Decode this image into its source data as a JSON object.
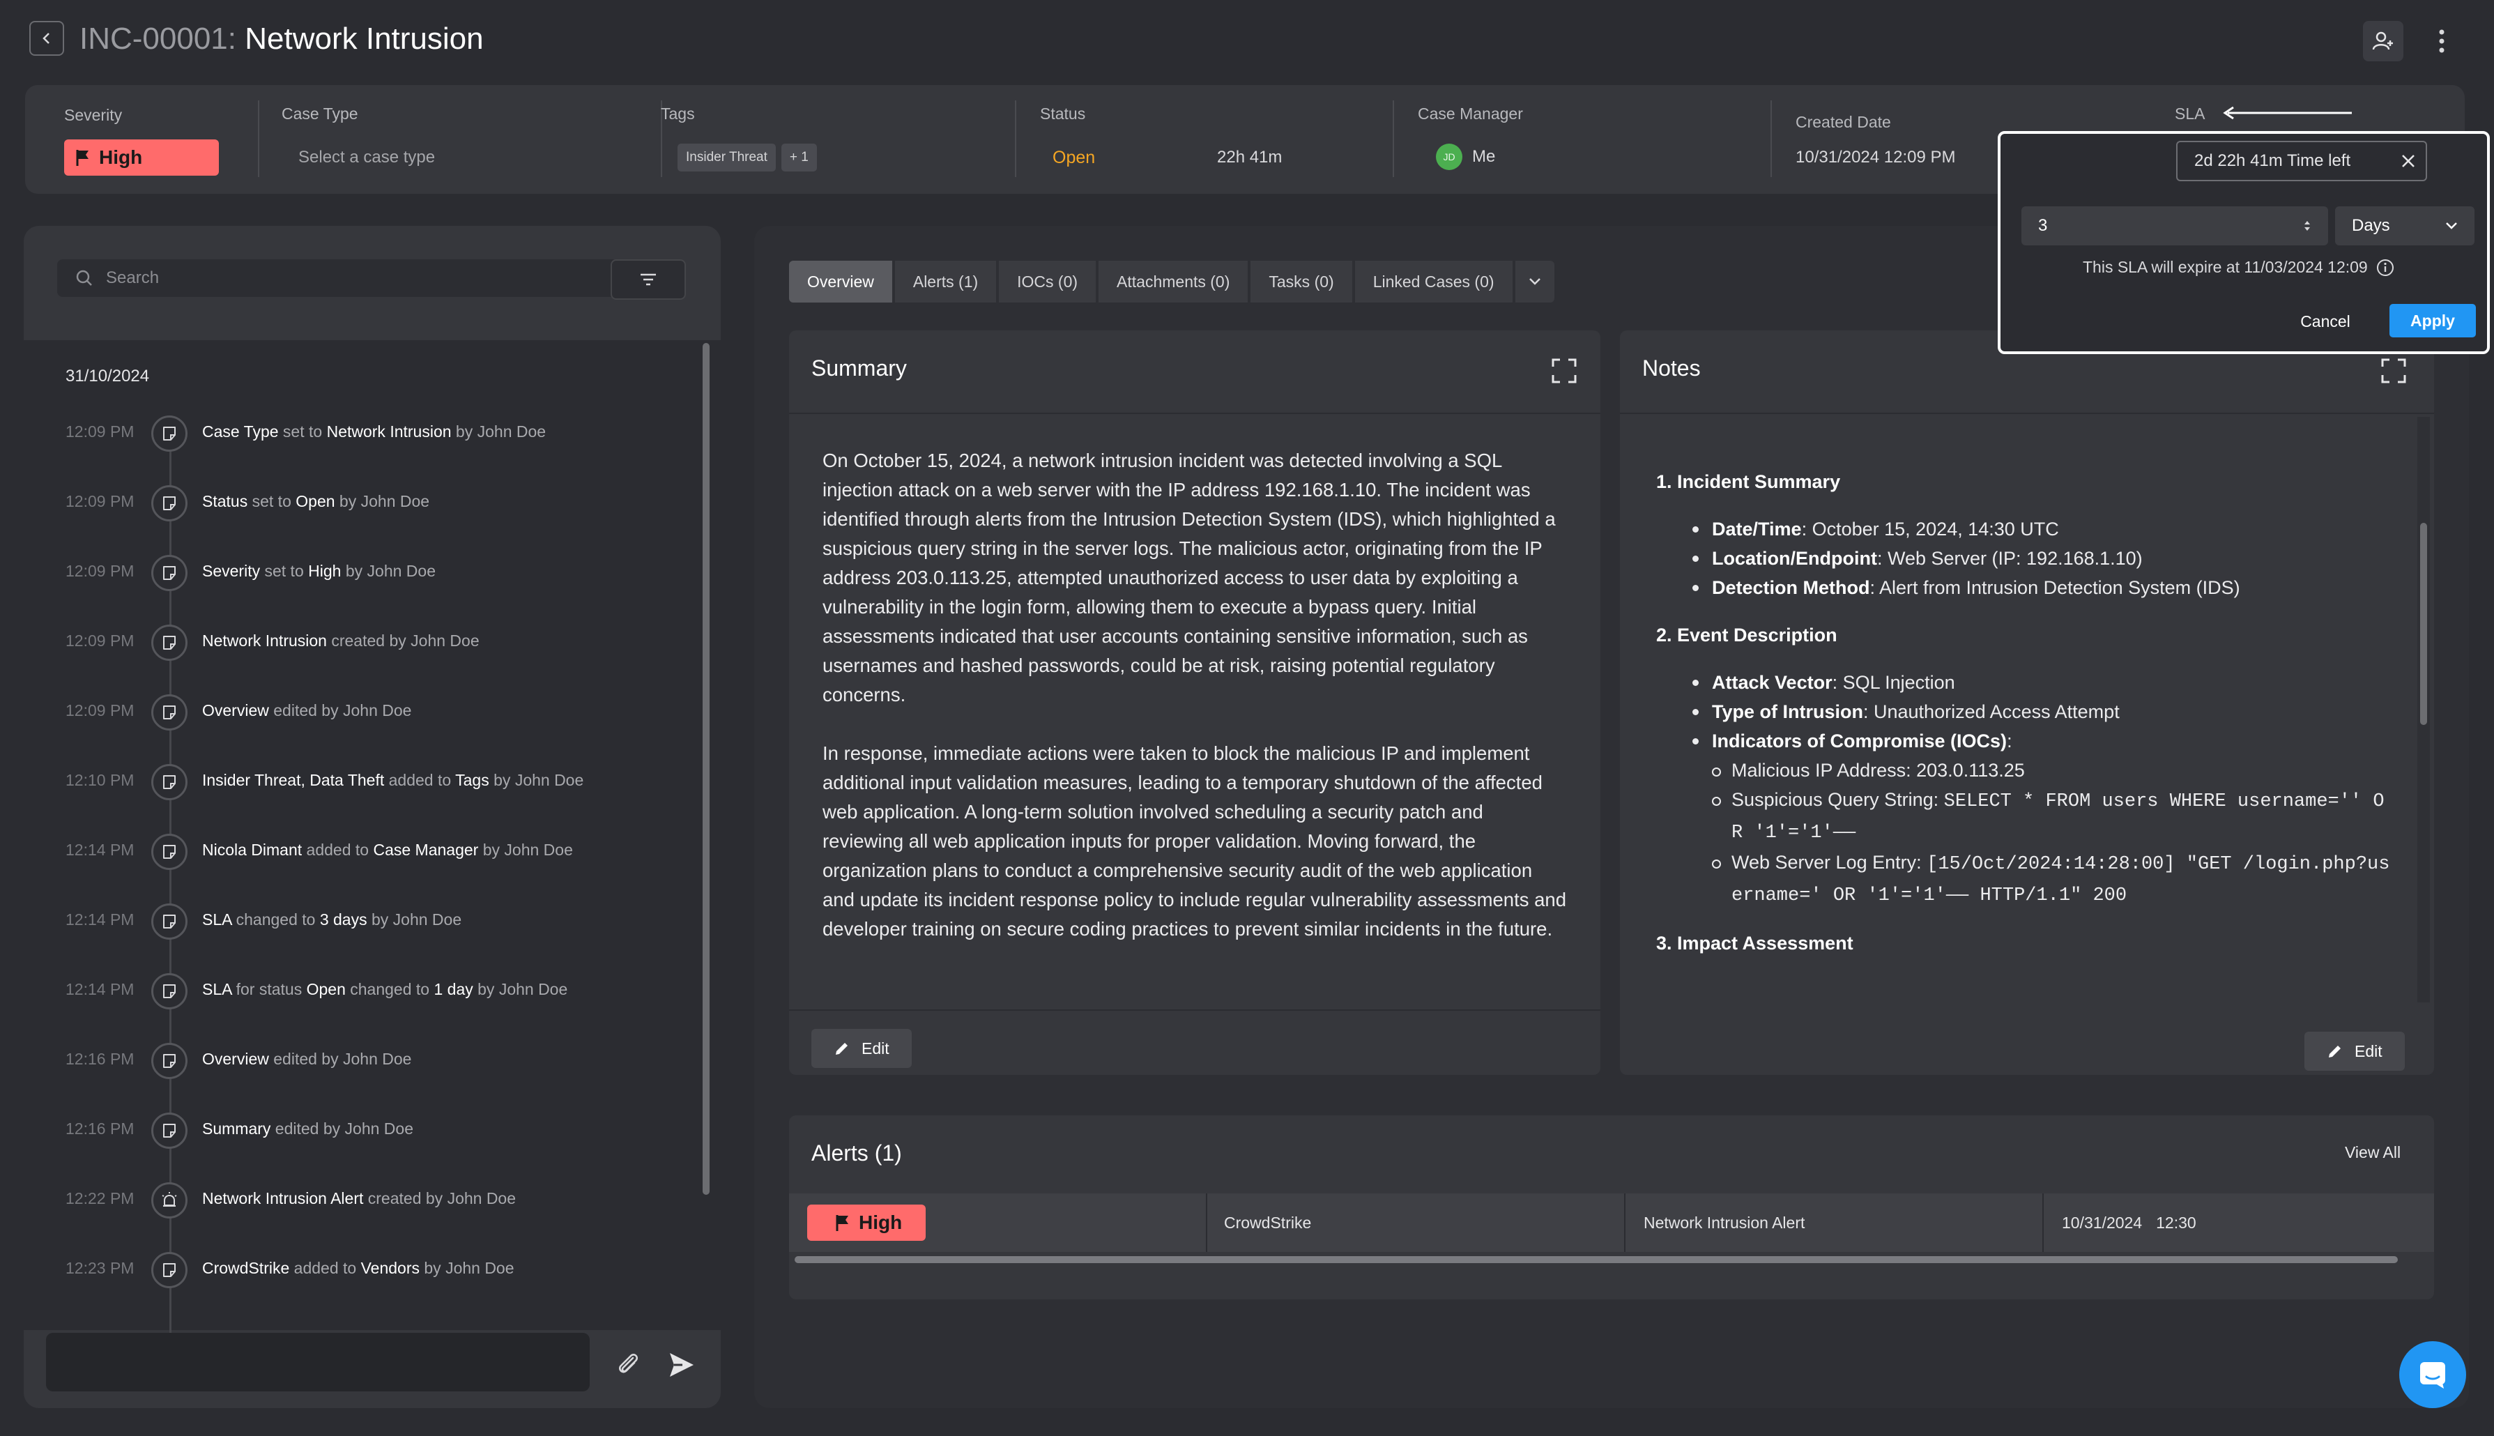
{
  "header": {
    "case_id": "INC-00001:",
    "case_title": "Network Intrusion"
  },
  "info_bar": {
    "severity_label": "Severity",
    "severity_value": "High",
    "case_type_label": "Case Type",
    "case_type_placeholder": "Select a case type",
    "tags_label": "Tags",
    "tags": [
      "Insider Threat",
      "+ 1"
    ],
    "status_label": "Status",
    "status_value": "Open",
    "status_time": "22h 41m",
    "case_manager_label": "Case Manager",
    "case_manager_initials": "JD",
    "case_manager_value": "Me",
    "created_label": "Created Date",
    "created_value": "10/31/2024 12:09 PM",
    "sla_label": "SLA"
  },
  "sla_popover": {
    "input_value": "2d 22h 41m Time left",
    "number_value": "3",
    "unit_value": "Days",
    "expire_text": "This SLA will expire at 11/03/2024 12:09",
    "cancel_label": "Cancel",
    "apply_label": "Apply"
  },
  "activity": {
    "search_placeholder": "Search",
    "date": "31/10/2024",
    "items": [
      {
        "time": "12:09 PM",
        "parts": [
          [
            "Case Type",
            "em"
          ],
          [
            " set to ",
            ""
          ],
          [
            "Network Intrusion",
            "em"
          ],
          [
            " by ",
            ""
          ],
          [
            "John Doe",
            ""
          ]
        ]
      },
      {
        "time": "12:09 PM",
        "parts": [
          [
            "Status",
            "em"
          ],
          [
            " set to ",
            ""
          ],
          [
            "Open",
            "em"
          ],
          [
            " by ",
            ""
          ],
          [
            "John Doe",
            ""
          ]
        ]
      },
      {
        "time": "12:09 PM",
        "parts": [
          [
            "Severity",
            "em"
          ],
          [
            " set to ",
            ""
          ],
          [
            "High",
            "em"
          ],
          [
            " by ",
            ""
          ],
          [
            "John Doe",
            ""
          ]
        ]
      },
      {
        "time": "12:09 PM",
        "parts": [
          [
            "Network Intrusion",
            "em"
          ],
          [
            " created by ",
            ""
          ],
          [
            "John Doe",
            ""
          ]
        ]
      },
      {
        "time": "12:09 PM",
        "parts": [
          [
            "Overview",
            "em"
          ],
          [
            " edited by ",
            ""
          ],
          [
            "John Doe",
            ""
          ]
        ]
      },
      {
        "time": "12:10 PM",
        "parts": [
          [
            "Insider Threat, Data Theft",
            "em"
          ],
          [
            " added to ",
            ""
          ],
          [
            "Tags",
            "em"
          ],
          [
            " by ",
            ""
          ],
          [
            "John Doe",
            ""
          ]
        ]
      },
      {
        "time": "12:14 PM",
        "parts": [
          [
            "Nicola Dimant",
            "em"
          ],
          [
            " added to ",
            ""
          ],
          [
            "Case Manager",
            "em"
          ],
          [
            " by ",
            ""
          ],
          [
            "John Doe",
            ""
          ]
        ]
      },
      {
        "time": "12:14 PM",
        "parts": [
          [
            "SLA",
            "em"
          ],
          [
            " changed to ",
            ""
          ],
          [
            "3 days",
            "em"
          ],
          [
            " by ",
            ""
          ],
          [
            "John Doe",
            ""
          ]
        ]
      },
      {
        "time": "12:14 PM",
        "parts": [
          [
            "SLA",
            "em"
          ],
          [
            " for status ",
            ""
          ],
          [
            "Open",
            "em"
          ],
          [
            " changed to ",
            ""
          ],
          [
            "1 day",
            "em"
          ],
          [
            " by ",
            ""
          ],
          [
            "John Doe",
            ""
          ]
        ]
      },
      {
        "time": "12:16 PM",
        "parts": [
          [
            "Overview",
            "em"
          ],
          [
            " edited by ",
            ""
          ],
          [
            "John Doe",
            ""
          ]
        ]
      },
      {
        "time": "12:16 PM",
        "parts": [
          [
            "Summary",
            "em"
          ],
          [
            " edited by ",
            ""
          ],
          [
            "John Doe",
            ""
          ]
        ]
      },
      {
        "time": "12:22 PM",
        "parts": [
          [
            "Network Intrusion Alert",
            "em"
          ],
          [
            " created by ",
            ""
          ],
          [
            "John Doe",
            ""
          ]
        ],
        "icon": "alarm"
      },
      {
        "time": "12:23 PM",
        "parts": [
          [
            "CrowdStrike",
            "em"
          ],
          [
            " added to ",
            ""
          ],
          [
            "Vendors",
            "em"
          ],
          [
            " by ",
            ""
          ],
          [
            "John Doe",
            ""
          ]
        ]
      }
    ]
  },
  "tabs": [
    "Overview",
    "Alerts (1)",
    "IOCs (0)",
    "Attachments (0)",
    "Tasks (0)",
    "Linked Cases (0)"
  ],
  "summary": {
    "title": "Summary",
    "paragraphs": [
      "On October 15, 2024, a network intrusion incident was detected involving a SQL injection attack on a web server with the IP address 192.168.1.10. The incident was identified through alerts from the Intrusion Detection System (IDS), which highlighted a suspicious query string in the server logs. The malicious actor, originating from the IP address 203.0.113.25, attempted unauthorized access to user data by exploiting a vulnerability in the login form, allowing them to execute a bypass query. Initial assessments indicated that user accounts containing sensitive information, such as usernames and hashed passwords, could be at risk, raising potential regulatory concerns.",
      "In response, immediate actions were taken to block the malicious IP and implement additional input validation measures, leading to a temporary shutdown of the affected web application. A long-term solution involved scheduling a security patch and reviewing all web application inputs for proper validation. Moving forward, the organization plans to conduct a comprehensive security audit of the web application and update its incident response policy to include regular vulnerability assessments and developer training on secure coding practices to prevent similar incidents in the future."
    ],
    "edit_label": "Edit"
  },
  "notes": {
    "title": "Notes",
    "h1": "1. Incident Summary",
    "s1": [
      {
        "k": "Date/Time",
        "v": ": October 15, 2024, 14:30 UTC"
      },
      {
        "k": "Location/Endpoint",
        "v": ": Web Server (IP: 192.168.1.10)"
      },
      {
        "k": "Detection Method",
        "v": ": Alert from Intrusion Detection System (IDS)"
      }
    ],
    "h2": "2. Event Description",
    "s2": [
      {
        "k": "Attack Vector",
        "v": ": SQL Injection"
      },
      {
        "k": "Type of Intrusion",
        "v": ": Unauthorized Access Attempt"
      },
      {
        "k": "Indicators of Compromise (IOCs)",
        "v": ":"
      }
    ],
    "ioc1": "Malicious IP Address: 203.0.113.25",
    "ioc2_label": "Suspicious Query String: ",
    "ioc2_code": "SELECT * FROM users WHERE username='' OR '1'='1'——",
    "ioc3_label": "Web Server Log Entry: ",
    "ioc3_code": "[15/Oct/2024:14:28:00] \"GET /login.php?username=' OR '1'='1'—— HTTP/1.1\" 200",
    "h3": "3. Impact Assessment",
    "edit_label": "Edit"
  },
  "alerts": {
    "title": "Alerts (1)",
    "view_all": "View All",
    "row": {
      "severity": "High",
      "vendor": "CrowdStrike",
      "name": "Network Intrusion Alert",
      "date": "10/31/2024",
      "time": "12:30"
    }
  },
  "colors": {
    "severity_high": "#ff6b6b",
    "status_open": "#f5a623",
    "primary": "#2196f3",
    "avatar": "#4caf50"
  }
}
